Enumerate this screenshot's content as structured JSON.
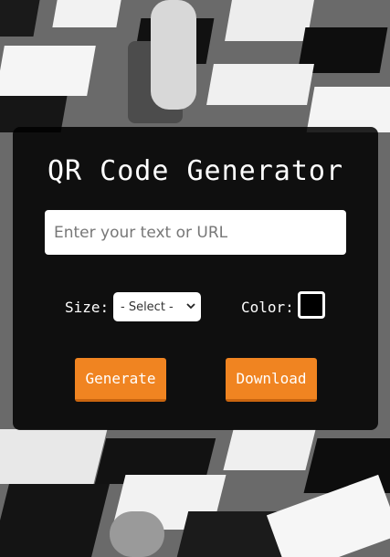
{
  "app": {
    "title": "QR Code Generator"
  },
  "form": {
    "text_input": {
      "value": "",
      "placeholder": "Enter your text or URL"
    },
    "size_label": "Size:",
    "size_select": {
      "selected": "- Select -"
    },
    "color_label": "Color:",
    "color_value": "#000000"
  },
  "actions": {
    "generate_label": "Generate",
    "download_label": "Download"
  },
  "colors": {
    "button_accent": "#f08421",
    "card_background": "#000000",
    "text": "#ffffff"
  }
}
